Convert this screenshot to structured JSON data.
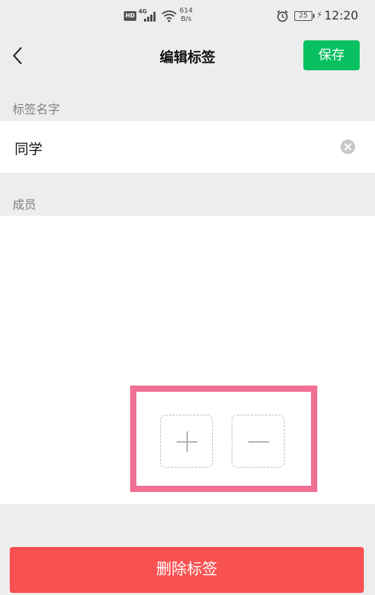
{
  "status_bar": {
    "hd": "HD",
    "network": "4G",
    "speed_value": "614",
    "speed_unit": "B/s",
    "battery": "25",
    "time": "12:20",
    "icons": [
      "signal-icon",
      "wifi-icon",
      "alarm-icon",
      "battery-icon",
      "charging-icon"
    ]
  },
  "nav": {
    "title": "编辑标签",
    "save_label": "保存",
    "back_icon": "chevron-left-icon"
  },
  "tag_name": {
    "section_label": "标签名字",
    "value": "同学",
    "clear_icon": "clear-circle-icon"
  },
  "members": {
    "section_label": "成员",
    "add_icon": "plus-icon",
    "remove_icon": "minus-icon"
  },
  "delete_label": "删除标签",
  "colors": {
    "accent_green": "#07c160",
    "danger_red": "#f85151",
    "highlight_pink": "#f07094",
    "background": "#ededed"
  }
}
